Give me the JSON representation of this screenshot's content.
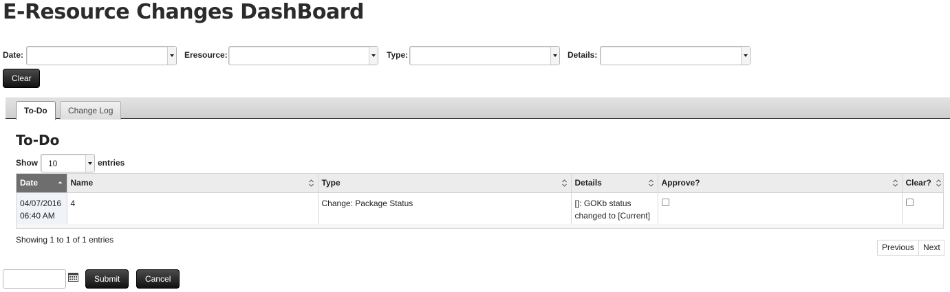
{
  "page": {
    "title": "E-Resource Changes DashBoard"
  },
  "filters": {
    "date_label": "Date:",
    "eresource_label": "Eresource:",
    "type_label": "Type:",
    "details_label": "Details:",
    "clear_button": "Clear"
  },
  "tabs": [
    {
      "label": "To-Do",
      "active": true
    },
    {
      "label": "Change Log",
      "active": false
    }
  ],
  "todo": {
    "title": "To-Do",
    "show_label": "Show",
    "entries_value": "10",
    "entries_label": "entries",
    "columns": [
      "Date",
      "Name",
      "Type",
      "Details",
      "Approve?",
      "Clear?"
    ],
    "rows": [
      {
        "date_line1": "04/07/2016",
        "date_line2": "06:40 AM",
        "name": "4",
        "type": "Change: Package Status",
        "details_line1": "[]: GOKb status",
        "details_line2": "changed to [Current]"
      }
    ],
    "info_text": "Showing 1 to 1 of 1 entries",
    "previous_label": "Previous",
    "next_label": "Next"
  },
  "footer": {
    "submit_button": "Submit",
    "cancel_button": "Cancel"
  },
  "icons": {
    "sort_up": "sort-asc-icon",
    "sort_both": "sort-both-icon",
    "calendar": "calendar-icon",
    "dropdown": "chevron-down-icon"
  }
}
